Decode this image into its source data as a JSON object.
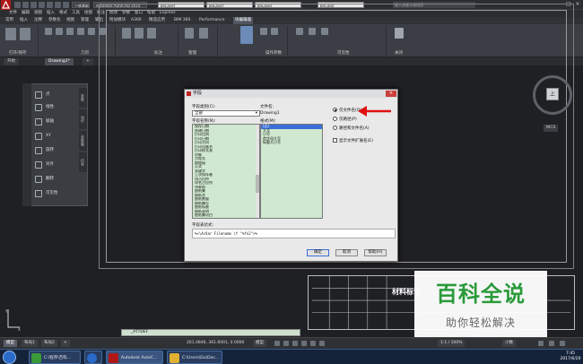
{
  "titlebar": {
    "app_name": "Autodesk AutoCAD 2014",
    "workspace": "三维基础",
    "layer_combos": [
      "ByLayer",
      "ByLayer",
      "ByLayer",
      "ByColor"
    ],
    "search_placeholder": "键入关键字或短语"
  },
  "menu": [
    "文件",
    "编辑",
    "视图",
    "插入",
    "格式",
    "工具",
    "绘图",
    "标注",
    "修改",
    "参数",
    "窗口",
    "帮助",
    "Express"
  ],
  "ribbon_tabs": [
    "常用",
    "插入",
    "注释",
    "参数化",
    "视图",
    "管理",
    "输出",
    "附加模块",
    "A360",
    "精选应用",
    "BIM 360",
    "Performance",
    "块编辑器"
  ],
  "ribbon_panels": [
    "打开/保存",
    "几何",
    "标注",
    "管理",
    "操作参数",
    "可见性",
    "关闭"
  ],
  "file_tabs": [
    "开始",
    "Drawing1*"
  ],
  "palette": {
    "items": [
      "点",
      "线性",
      "极轴",
      "XY",
      "旋转",
      "对齐",
      "翻转",
      "可见性"
    ],
    "side_tabs": [
      "参数",
      "动作",
      "参数集",
      "约束"
    ]
  },
  "viewcube": {
    "face": "上",
    "wcs": "WCS"
  },
  "dialog": {
    "title": "字段",
    "category_label": "字段类别(C):",
    "category_value": "全部",
    "field_names_label": "字段名称(N):",
    "field_names": [
      "保存日期",
      "创建日期",
      "打印比例",
      "打印日期",
      "打印方向",
      "打印设备名",
      "打印样式表",
      "对象",
      "方程式",
      "超链接",
      "公式",
      "关键字",
      "上次保存者",
      "块占位符",
      "块名占位符",
      "块参照",
      "图纸集",
      "图纸名",
      "图纸数量",
      "图纸编号",
      "图纸标题",
      "图纸说明",
      "图纸集项目",
      "图纸集占位符",
      "图纸视图",
      "图纸集属性",
      "文件名",
      "文件大小",
      "系统变量",
      "修订号",
      "作者",
      "页面设置名称",
      "主题",
      "注释",
      "标题"
    ],
    "selected_field": "文件名",
    "filename_label": "文件名:",
    "filename_value": "Drawing1",
    "format_label": "格式(M):",
    "formats": [
      "(无)",
      "大写",
      "小写",
      "首字母大写",
      "标题大小写"
    ],
    "selected_format": "(无)",
    "option_filename_only": "仅文件名(O)",
    "option_path_only": "仅路径(P)",
    "option_path_and_filename": "路径和文件名(A)",
    "option_show_extension": "显示文件扩展名(E)",
    "expression_label": "字段表达式:",
    "expression_value": "%<\\AcVar Filename \\f \"%fn2\">%",
    "ok_label": "确定",
    "cancel_label": "取消",
    "help_label": "帮助(H)"
  },
  "titleblock_title": "材料标记",
  "watermark": {
    "line1": "百科全说",
    "line2": "助你轻松解决"
  },
  "command_line": "_ATTDEF",
  "layout_tabs": [
    "模型",
    "布局1",
    "布局2"
  ],
  "status": {
    "coords": "261.0846, 361.6001, 0.0000",
    "mode": "模型",
    "scale": "1:1 / 100%",
    "units": "小数"
  },
  "taskbar": {
    "apps": [
      "C:\\程序\\百科...",
      "",
      "Autodesk AutoC...",
      "C:\\Users\\Du\\Doc..."
    ],
    "time": "7:45",
    "date": "2017/6/20"
  },
  "colors": {
    "accent": "#3a6fd8",
    "arrow": "#e01010",
    "watermark_green": "#2a9a3a"
  }
}
